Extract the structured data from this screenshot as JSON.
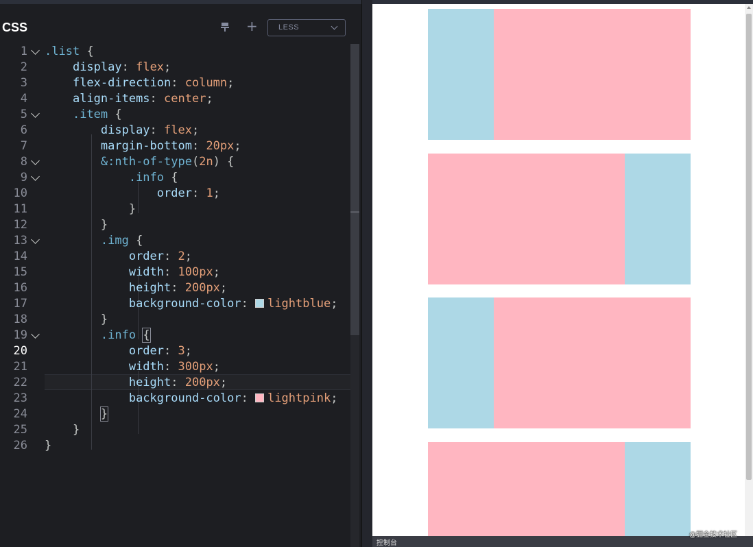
{
  "editor": {
    "title": "CSS",
    "pin_icon": "pin-icon",
    "add_icon": "plus-icon",
    "add_symbol": "+",
    "preprocessor": "LESS",
    "active_line": "20",
    "line_numbers": [
      "1",
      "2",
      "3",
      "4",
      "5",
      "6",
      "7",
      "8",
      "9",
      "10",
      "11",
      "12",
      "13",
      "14",
      "15",
      "16",
      "17",
      "18",
      "19",
      "20",
      "21",
      "22",
      "23",
      "24",
      "25",
      "26"
    ],
    "code_lines": [
      [
        [
          ".list",
          "sel"
        ],
        [
          " {",
          "pun"
        ]
      ],
      [
        [
          "    ",
          "pun"
        ],
        [
          "display",
          "prop"
        ],
        [
          ": ",
          "pun"
        ],
        [
          "flex",
          "val"
        ],
        [
          ";",
          "pun"
        ]
      ],
      [
        [
          "    ",
          "pun"
        ],
        [
          "flex-direction",
          "prop"
        ],
        [
          ": ",
          "pun"
        ],
        [
          "column",
          "val"
        ],
        [
          ";",
          "pun"
        ]
      ],
      [
        [
          "    ",
          "pun"
        ],
        [
          "align-items",
          "prop"
        ],
        [
          ": ",
          "pun"
        ],
        [
          "center",
          "val"
        ],
        [
          ";",
          "pun"
        ]
      ],
      [
        [
          "    ",
          "pun"
        ],
        [
          ".item",
          "sel"
        ],
        [
          " {",
          "pun"
        ]
      ],
      [
        [
          "        ",
          "pun"
        ],
        [
          "display",
          "prop"
        ],
        [
          ": ",
          "pun"
        ],
        [
          "flex",
          "val"
        ],
        [
          ";",
          "pun"
        ]
      ],
      [
        [
          "        ",
          "pun"
        ],
        [
          "margin-bottom",
          "prop"
        ],
        [
          ": ",
          "pun"
        ],
        [
          "20px",
          "num"
        ],
        [
          ";",
          "pun"
        ]
      ],
      [
        [
          "        ",
          "pun"
        ],
        [
          "&:nth-of-type",
          "sel"
        ],
        [
          "(",
          "pun"
        ],
        [
          "2n",
          "num"
        ],
        [
          ") {",
          "pun"
        ]
      ],
      [
        [
          "            ",
          "pun"
        ],
        [
          ".info",
          "sel"
        ],
        [
          " {",
          "pun"
        ]
      ],
      [
        [
          "                ",
          "pun"
        ],
        [
          "order",
          "prop"
        ],
        [
          ": ",
          "pun"
        ],
        [
          "1",
          "num"
        ],
        [
          ";",
          "pun"
        ]
      ],
      [
        [
          "            ",
          "pun"
        ],
        [
          "}",
          "pun"
        ]
      ],
      [
        [
          "        ",
          "pun"
        ],
        [
          "}",
          "pun"
        ]
      ],
      [
        [
          "        ",
          "pun"
        ],
        [
          ".img",
          "sel"
        ],
        [
          " {",
          "pun"
        ]
      ],
      [
        [
          "            ",
          "pun"
        ],
        [
          "order",
          "prop"
        ],
        [
          ": ",
          "pun"
        ],
        [
          "2",
          "num"
        ],
        [
          ";",
          "pun"
        ]
      ],
      [
        [
          "            ",
          "pun"
        ],
        [
          "width",
          "prop"
        ],
        [
          ": ",
          "pun"
        ],
        [
          "100px",
          "num"
        ],
        [
          ";",
          "pun"
        ]
      ],
      [
        [
          "            ",
          "pun"
        ],
        [
          "height",
          "prop"
        ],
        [
          ": ",
          "pun"
        ],
        [
          "200px",
          "num"
        ],
        [
          ";",
          "pun"
        ]
      ],
      [
        [
          "            ",
          "pun"
        ],
        [
          "background-color",
          "prop"
        ],
        [
          ": ",
          "pun"
        ],
        [
          "#add8e6",
          "swatch"
        ],
        [
          "lightblue",
          "val"
        ],
        [
          ";",
          "pun"
        ]
      ],
      [
        [
          "        ",
          "pun"
        ],
        [
          "}",
          "pun"
        ]
      ],
      [
        [
          "        ",
          "pun"
        ],
        [
          ".info",
          "sel"
        ],
        [
          " ",
          "pun"
        ],
        [
          "{",
          "brk"
        ]
      ],
      [
        [
          "            ",
          "pun"
        ],
        [
          "order",
          "prop"
        ],
        [
          ": ",
          "pun"
        ],
        [
          "3",
          "num"
        ],
        [
          ";",
          "pun"
        ]
      ],
      [
        [
          "            ",
          "pun"
        ],
        [
          "width",
          "prop"
        ],
        [
          ": ",
          "pun"
        ],
        [
          "300px",
          "num"
        ],
        [
          ";",
          "pun"
        ]
      ],
      [
        [
          "            ",
          "pun"
        ],
        [
          "height",
          "prop"
        ],
        [
          ": ",
          "pun"
        ],
        [
          "200px",
          "num"
        ],
        [
          ";",
          "pun"
        ]
      ],
      [
        [
          "            ",
          "pun"
        ],
        [
          "background-color",
          "prop"
        ],
        [
          ": ",
          "pun"
        ],
        [
          "#ffb6c1",
          "swatch"
        ],
        [
          "lightpink",
          "val"
        ],
        [
          ";",
          "pun"
        ]
      ],
      [
        [
          "        ",
          "pun"
        ],
        [
          "}",
          "brk"
        ]
      ],
      [
        [
          "    ",
          "pun"
        ],
        [
          "}",
          "pun"
        ]
      ],
      [
        [
          "}",
          "pun"
        ]
      ]
    ],
    "foldable_lines": [
      1,
      5,
      8,
      9,
      13,
      19
    ]
  },
  "preview": {
    "items": [
      {
        "order": [
          "img",
          "info"
        ]
      },
      {
        "order": [
          "info",
          "img"
        ]
      },
      {
        "order": [
          "img",
          "info"
        ]
      },
      {
        "order": [
          "info",
          "img"
        ]
      }
    ],
    "img_color": "#add8e6",
    "info_color": "#ffb6c1"
  },
  "console": {
    "label": "控制台"
  },
  "watermark": "@掘金技术社区",
  "colors": {
    "editor_bg": "#1d1e22",
    "selector": "#6fb3d2",
    "property": "#a9dcfa",
    "value": "#e5a079"
  }
}
